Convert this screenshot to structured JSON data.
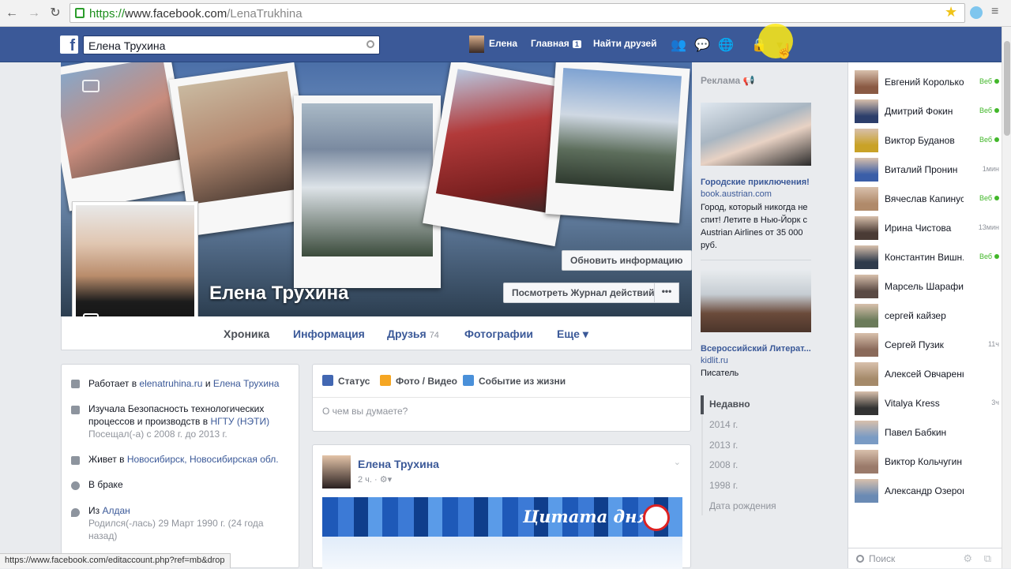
{
  "browser": {
    "url_scheme": "https://",
    "url_host": "www.facebook.com",
    "url_path": "/LenaTrukhina",
    "status_url": "https://www.facebook.com/editaccount.php?ref=mb&drop"
  },
  "topbar": {
    "search_value": "Елена Трухина",
    "user_name": "Елена",
    "home_label": "Главная",
    "home_badge": "1",
    "find_friends_label": "Найти друзей"
  },
  "profile": {
    "name": "Елена Трухина",
    "update_info_btn": "Обновить информацию",
    "activity_log_btn": "Посмотреть Журнал действий",
    "more_btn": "•••"
  },
  "tabs": [
    {
      "label": "Хроника"
    },
    {
      "label": "Информация"
    },
    {
      "label": "Друзья",
      "count": "74"
    },
    {
      "label": "Фотографии"
    },
    {
      "label": "Еще ▾"
    }
  ],
  "intro": {
    "work_prefix": "Работает в ",
    "work_link1": "elenatruhina.ru",
    "work_mid": " и ",
    "work_link2": "Елена Трухина",
    "edu_text": "Изучала Безопасность технологических процессов и производств в ",
    "edu_link": "НГТУ (НЭТИ)",
    "edu_sub": "Посещал(-а) с 2008 г. до 2013 г.",
    "lives_prefix": "Живет в ",
    "lives_link": "Новосибирск, Новосибирская обл.",
    "relationship": "В браке",
    "from_prefix": "Из ",
    "from_link": "Алдан",
    "born": "Родился(-лась) 29 Март 1990 г. (24 года назад)"
  },
  "composer": {
    "status_label": "Статус",
    "photo_label": "Фото / Видео",
    "event_label": "Событие из жизни",
    "placeholder": "О чем вы думаете?"
  },
  "post": {
    "author": "Елена Трухина",
    "time": "2 ч. · ",
    "banner_text": "Цитата дня"
  },
  "ads": {
    "title": "Реклама",
    "ad1_title": "Городские приключения!",
    "ad1_host": "book.austrian.com",
    "ad1_body": "Город, который никогда не спит! Летите в Нью-Йорк с Austrian Airlines от 35 000 руб.",
    "ad2_title": "Всероссийский Литерат...",
    "ad2_host": "kidlit.ru",
    "ad2_body": "Писатель"
  },
  "years": [
    "Недавно",
    "2014 г.",
    "2013 г.",
    "2008 г.",
    "1998 г.",
    "Дата рождения"
  ],
  "chat": {
    "search_label": "Поиск",
    "contacts": [
      {
        "name": "Евгений Корольков",
        "status": "Веб",
        "online": true,
        "color": "#8a5a44"
      },
      {
        "name": "Дмитрий Фокин",
        "status": "Веб",
        "online": true,
        "color": "#2c3e6b"
      },
      {
        "name": "Виктор Буданов",
        "status": "Веб",
        "online": true,
        "color": "#c9a227"
      },
      {
        "name": "Виталий Пронин",
        "status": "1мин",
        "online": false,
        "color": "#3a5ea8"
      },
      {
        "name": "Вячеслав Капинус",
        "status": "Веб",
        "online": true,
        "color": "#b08a6a"
      },
      {
        "name": "Ирина Чистова",
        "status": "13мин",
        "online": false,
        "color": "#4a3b35"
      },
      {
        "name": "Константин Вишн...",
        "status": "Веб",
        "online": true,
        "color": "#2f3b4c"
      },
      {
        "name": "Марсель Шарафиев",
        "status": "",
        "online": false,
        "color": "#5a4a44"
      },
      {
        "name": "сергей кайзер",
        "status": "",
        "online": false,
        "color": "#6b7b5a"
      },
      {
        "name": "Сергей Пузик",
        "status": "11ч",
        "online": false,
        "color": "#8a6a5a"
      },
      {
        "name": "Алексей Овчаренко",
        "status": "",
        "online": false,
        "color": "#a58a6a"
      },
      {
        "name": "Vitalya Kress",
        "status": "3ч",
        "online": false,
        "color": "#333333"
      },
      {
        "name": "Павел Бабкин",
        "status": "",
        "online": false,
        "color": "#7a9bc4"
      },
      {
        "name": "Виктор Кольчугин",
        "status": "",
        "online": false,
        "color": "#9a7a6a"
      },
      {
        "name": "Александр Озеров",
        "status": "",
        "online": false,
        "color": "#6a8ab4"
      }
    ]
  },
  "colors": {
    "fb_blue": "#3b5998",
    "link": "#3b5998",
    "online": "#42b72a"
  }
}
